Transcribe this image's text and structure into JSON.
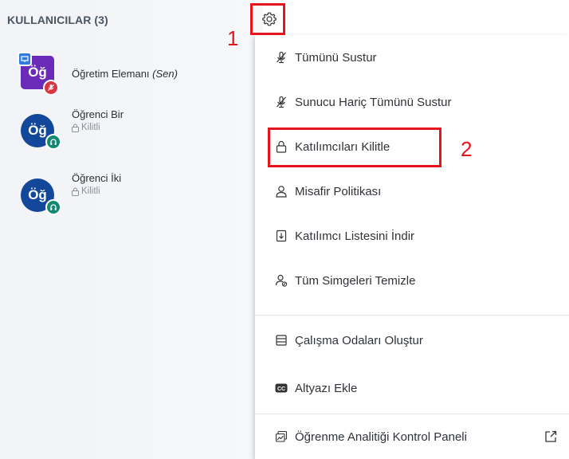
{
  "panel": {
    "title": "KULLANICILAR (3)"
  },
  "users": [
    {
      "avatar": "Öğ",
      "name": "Öğretim Elemanı",
      "suffix": "(Sen)",
      "status": ""
    },
    {
      "avatar": "Öğ",
      "name": "Öğrenci Bir",
      "status": "Kilitli"
    },
    {
      "avatar": "Öğ",
      "name": "Öğrenci İki",
      "status": "Kilitli"
    }
  ],
  "menu": {
    "items": [
      {
        "label": "Tümünü Sustur",
        "icon": "mic-off-icon"
      },
      {
        "label": "Sunucu Hariç Tümünü Sustur",
        "icon": "mic-off-icon"
      },
      {
        "label": "Katılımcıları Kilitle",
        "icon": "lock-icon"
      },
      {
        "label": "Misafir Politikası",
        "icon": "user-icon"
      },
      {
        "label": "Katılımcı Listesini İndir",
        "icon": "download-file-icon"
      },
      {
        "label": "Tüm Simgeleri Temizle",
        "icon": "clear-status-icon"
      },
      {
        "label": "Çalışma Odaları Oluştur",
        "icon": "rooms-icon"
      },
      {
        "label": "Altyazı Ekle",
        "icon": "closed-caption-icon"
      },
      {
        "label": "Öğrenme Analitiği Kontrol Paneli",
        "icon": "analytics-icon"
      }
    ]
  },
  "annotations": {
    "one": "1",
    "two": "2"
  },
  "colors": {
    "annotation": "#e8141c",
    "avatar_presenter": "#6a2bb8",
    "avatar_viewer": "#12479a",
    "muted_badge": "#d93642",
    "listen_badge": "#128a71"
  }
}
